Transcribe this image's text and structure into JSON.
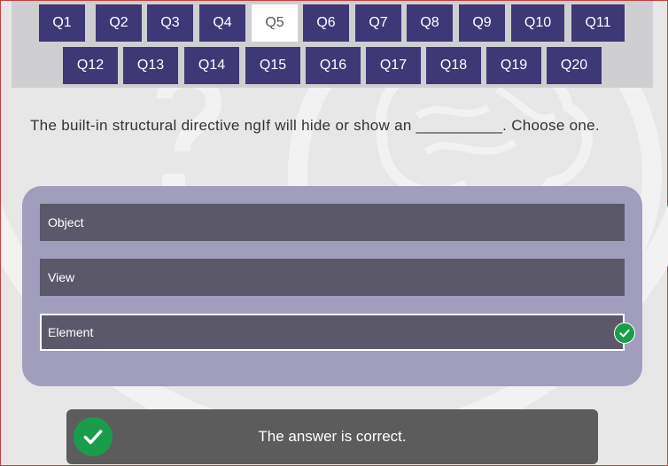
{
  "question_nav": {
    "row1": [
      "Q1",
      "Q2",
      "Q3",
      "Q4",
      "Q5",
      "Q6",
      "Q7",
      "Q8",
      "Q9",
      "Q10",
      "Q11"
    ],
    "row2": [
      "Q12",
      "Q13",
      "Q14",
      "Q15",
      "Q16",
      "Q17",
      "Q18",
      "Q19",
      "Q20"
    ],
    "active": "Q5"
  },
  "question": {
    "text": "The built-in structural directive ngIf will hide or show an __________. Choose one."
  },
  "options": [
    "Object",
    "View",
    "Element"
  ],
  "selected_option": "Element",
  "feedback": {
    "text": "The answer is correct."
  },
  "colors": {
    "nav_button": "#3f3877",
    "options_panel": "#a09dbd",
    "option": "#5b5869",
    "correct": "#1a9d4a",
    "feedback_bg": "#5c5c5c"
  },
  "icons": {
    "option_check": "check-circle-icon",
    "feedback_check": "check-circle-icon"
  }
}
